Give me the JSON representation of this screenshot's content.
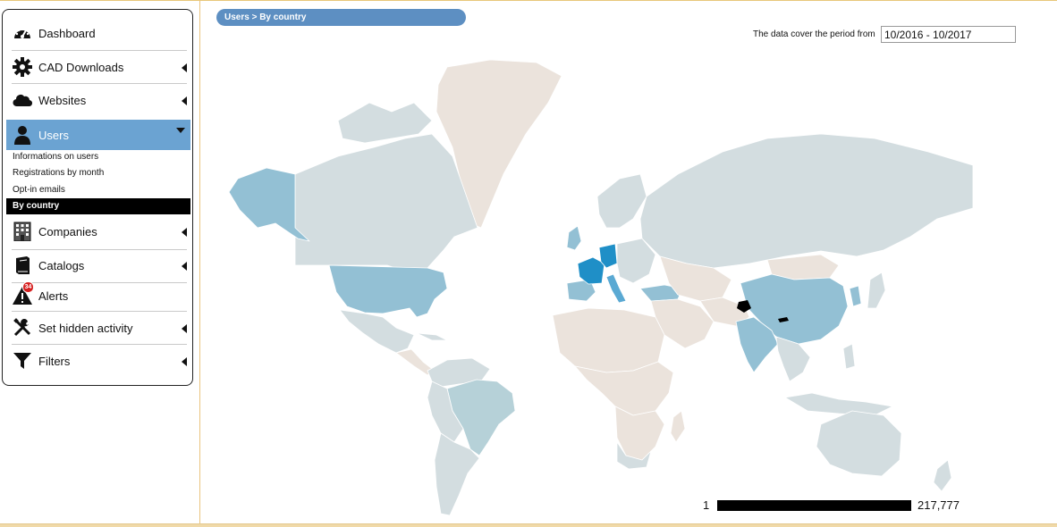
{
  "sidebar": {
    "items": [
      {
        "label": "Dashboard",
        "icon": "dashboard-icon"
      },
      {
        "label": "CAD Downloads",
        "icon": "gear-icon"
      },
      {
        "label": "Websites",
        "icon": "cloud-icon"
      },
      {
        "label": "Users",
        "icon": "user-icon",
        "active": true
      },
      {
        "label": "Companies",
        "icon": "building-icon"
      },
      {
        "label": "Catalogs",
        "icon": "book-icon"
      },
      {
        "label": "Alerts",
        "icon": "warning-icon",
        "badge": "34"
      },
      {
        "label": "Set hidden activity",
        "icon": "tools-icon"
      },
      {
        "label": "Filters",
        "icon": "filter-icon"
      }
    ],
    "users_submenu": [
      {
        "label": "Informations on users"
      },
      {
        "label": "Registrations by month"
      },
      {
        "label": "Opt-in emails"
      },
      {
        "label": "By country",
        "selected": true
      }
    ]
  },
  "breadcrumb": "Users > By country",
  "period": {
    "label": "The data cover the period from",
    "value": "10/2016 - 10/2017"
  },
  "legend": {
    "min": "1",
    "max": "217,777"
  },
  "colors": {
    "accent": "#6ba3d2",
    "breadcrumb": "#5d8fc2",
    "no_data": "#ebe3dc",
    "low": "#d3dde0",
    "mid": "#93c0d4",
    "high": "#1f8fc7",
    "max": "#000000"
  }
}
